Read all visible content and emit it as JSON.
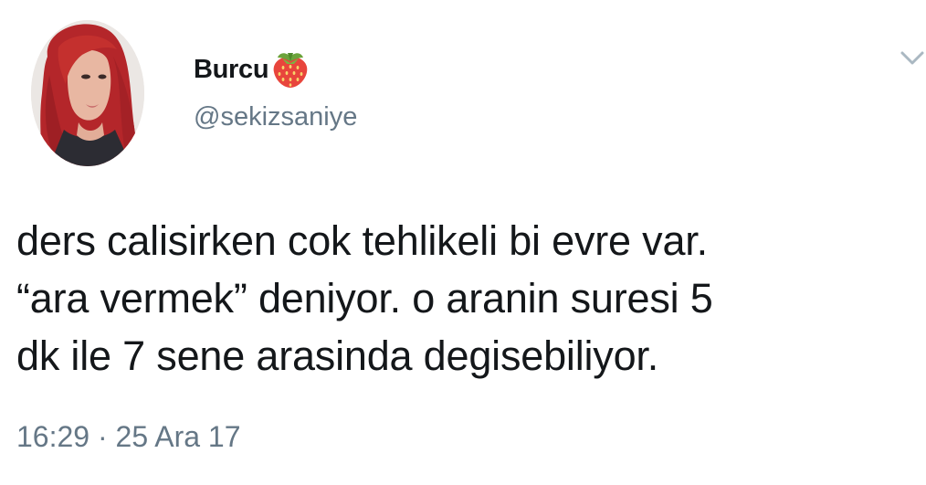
{
  "user": {
    "display_name": "Burcu",
    "display_name_emoji": "strawberry-icon",
    "handle": "@sekizsaniye",
    "avatar": "profile-photo"
  },
  "tweet": {
    "lines": [
      "ders calisirken cok tehlikeli bi evre var.",
      "“ara vermek” deniyor. o aranin suresi 5",
      "dk ile 7 sene arasinda degisebiliyor."
    ],
    "time": "16:29",
    "separator": "·",
    "date": "25 Ara 17"
  },
  "menu": {
    "icon": "chevron-down-icon"
  },
  "colors": {
    "text_primary": "#14171a",
    "text_secondary": "#657786",
    "background": "#ffffff",
    "chevron": "#aab8c2"
  }
}
